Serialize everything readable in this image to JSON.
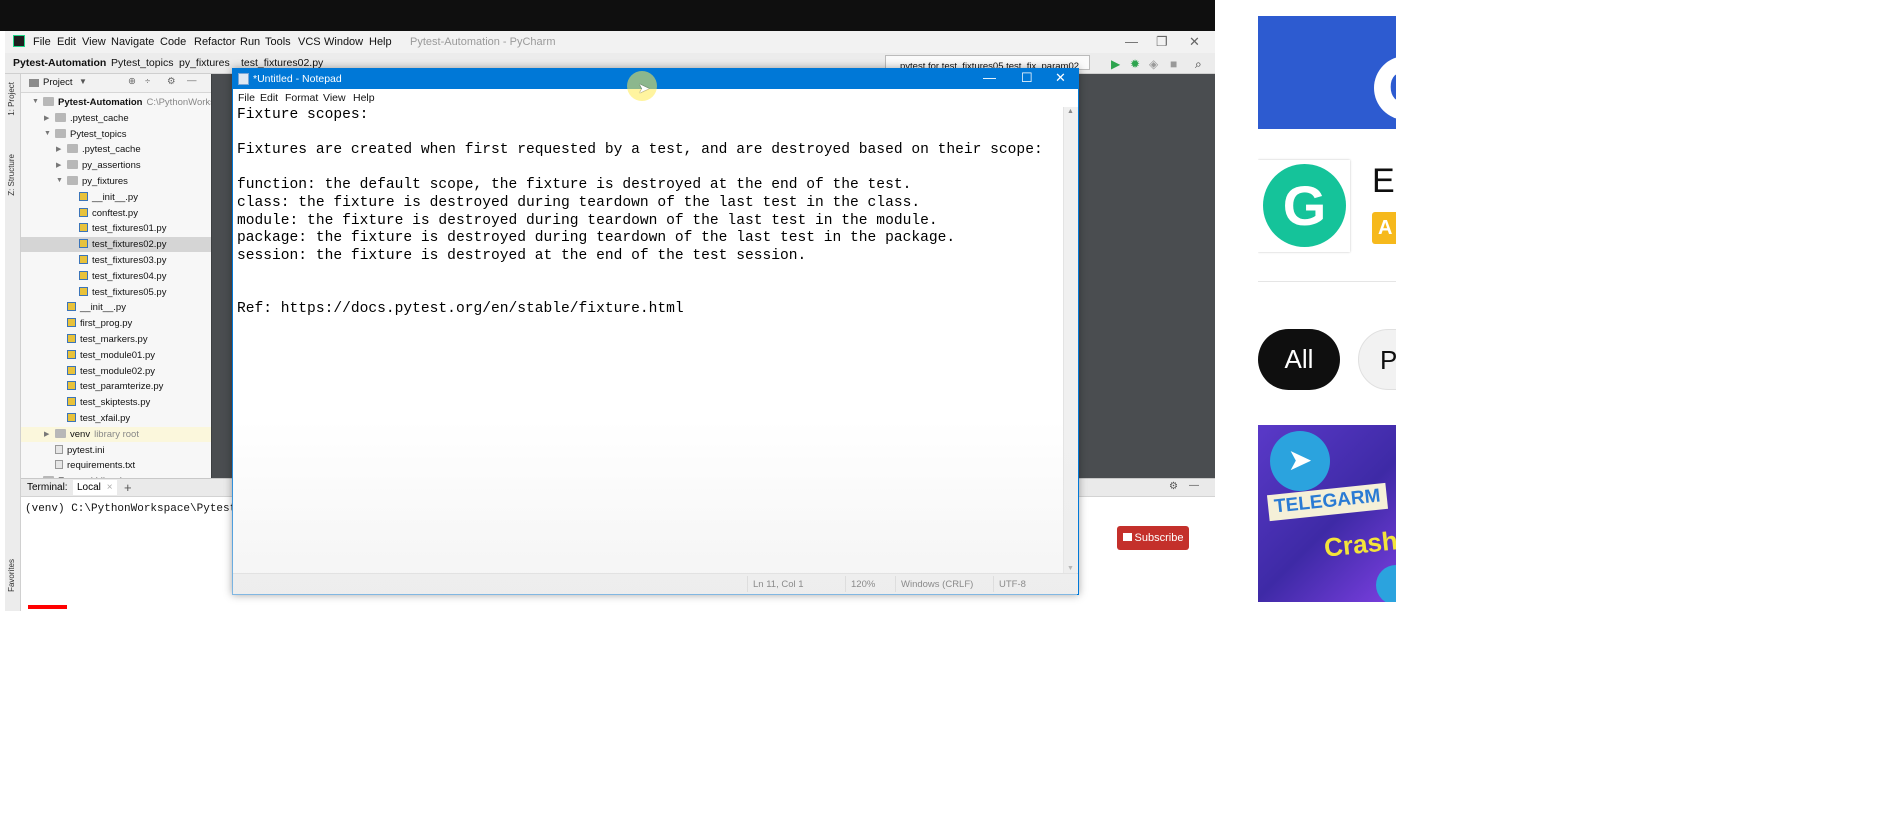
{
  "pycharm": {
    "menu": [
      "File",
      "Edit",
      "View",
      "Navigate",
      "Code",
      "Refactor",
      "Run",
      "Tools",
      "VCS",
      "Window",
      "Help"
    ],
    "window_title": "Pytest-Automation - PyCharm",
    "breadcrumbs": [
      "Pytest-Automation",
      "Pytest_topics",
      "py_fixtures",
      "test_fixtures02.py"
    ],
    "run_config": "pytest for test_fixtures05.test_fix_param02",
    "side_tabs": [
      "1: Project",
      "Z: Structure",
      "Favorites"
    ],
    "project_panel_label": "Project",
    "tree": [
      {
        "label": "Pytest-Automation",
        "sub": "C:\\PythonWorkspace",
        "type": "folder",
        "depth": 0,
        "open": true,
        "bold": true
      },
      {
        "label": ".pytest_cache",
        "type": "folder",
        "depth": 1,
        "open": false
      },
      {
        "label": "Pytest_topics",
        "type": "folder",
        "depth": 1,
        "open": true
      },
      {
        "label": ".pytest_cache",
        "type": "folder",
        "depth": 2,
        "open": false
      },
      {
        "label": "py_assertions",
        "type": "folder",
        "depth": 2,
        "open": false
      },
      {
        "label": "py_fixtures",
        "type": "folder",
        "depth": 2,
        "open": true
      },
      {
        "label": "__init__.py",
        "type": "py",
        "depth": 3
      },
      {
        "label": "conftest.py",
        "type": "py",
        "depth": 3
      },
      {
        "label": "test_fixtures01.py",
        "type": "py",
        "depth": 3
      },
      {
        "label": "test_fixtures02.py",
        "type": "py",
        "depth": 3,
        "selected": true
      },
      {
        "label": "test_fixtures03.py",
        "type": "py",
        "depth": 3
      },
      {
        "label": "test_fixtures04.py",
        "type": "py",
        "depth": 3
      },
      {
        "label": "test_fixtures05.py",
        "type": "py",
        "depth": 3
      },
      {
        "label": "__init__.py",
        "type": "py",
        "depth": 2
      },
      {
        "label": "first_prog.py",
        "type": "py",
        "depth": 2
      },
      {
        "label": "test_markers.py",
        "type": "py",
        "depth": 2
      },
      {
        "label": "test_module01.py",
        "type": "py",
        "depth": 2
      },
      {
        "label": "test_module02.py",
        "type": "py",
        "depth": 2
      },
      {
        "label": "test_paramterize.py",
        "type": "py",
        "depth": 2
      },
      {
        "label": "test_skiptests.py",
        "type": "py",
        "depth": 2
      },
      {
        "label": "test_xfail.py",
        "type": "py",
        "depth": 2
      },
      {
        "label": "venv",
        "sub": "library root",
        "type": "folder",
        "depth": 1,
        "open": false,
        "highlight": true
      },
      {
        "label": "pytest.ini",
        "type": "txt",
        "depth": 1
      },
      {
        "label": "requirements.txt",
        "type": "txt",
        "depth": 1
      },
      {
        "label": "External Libraries",
        "type": "folder",
        "depth": 0,
        "open": false
      }
    ],
    "terminal": {
      "label": "Terminal:",
      "tab": "Local",
      "tab_close": "×",
      "add": "+",
      "line": "(venv) C:\\PythonWorkspace\\Pytest-"
    }
  },
  "notepad": {
    "title": "*Untitled - Notepad",
    "menu": [
      "File",
      "Edit",
      "Format",
      "View",
      "Help"
    ],
    "lines": [
      "Fixture scopes:",
      "",
      "Fixtures are created when first requested by a test, and are destroyed based on their scope:",
      "",
      "function: the default scope, the fixture is destroyed at the end of the test.",
      "class: the fixture is destroyed during teardown of the last test in the class.",
      "module: the fixture is destroyed during teardown of the last test in the module.",
      "package: the fixture is destroyed during teardown of the last test in the package.",
      "session: the fixture is destroyed at the end of the test session.",
      "",
      "",
      "Ref: https://docs.pytest.org/en/stable/fixture.html"
    ],
    "status": {
      "position": "Ln 11, Col 1",
      "zoom": "120%",
      "line_ending": "Windows (CRLF)",
      "encoding": "UTF-8"
    }
  },
  "video": {
    "subscribe_label": "Subscribe",
    "progress": 0.033
  },
  "sidebar": {
    "ad_name": "Ec",
    "ad_badge": "A",
    "chips": [
      "All",
      "P"
    ],
    "thumb_text_1": "TELEGARM",
    "thumb_text_2": "Crash"
  },
  "colors": {
    "notepad_titlebar": "#0078d7",
    "progress": "#ff0000",
    "grammarly": "#15c39a",
    "ad_banner": "#2d5bd0"
  }
}
